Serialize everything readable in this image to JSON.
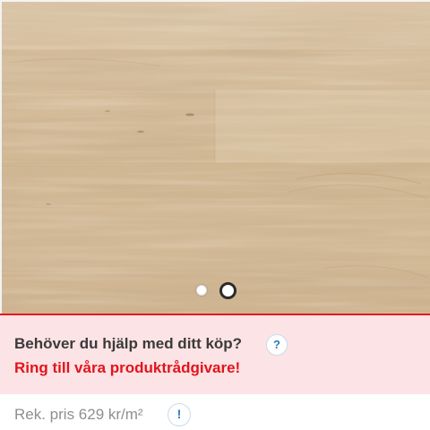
{
  "product_image": {
    "alt": "",
    "slide_count": 2,
    "active_slide": 2
  },
  "help": {
    "question": "Behöver du hjälp med ditt köp?",
    "question_icon_glyph": "?",
    "call_text": "Ring till våra produktrådgivare!",
    "accent_color": "#e2141c",
    "background_color": "#fce3e5"
  },
  "price": {
    "text": "Rek. pris 629 kr/m²",
    "info_icon_glyph": "!"
  },
  "icons": {
    "help": "question-circle-icon",
    "info": "info-circle-icon"
  }
}
